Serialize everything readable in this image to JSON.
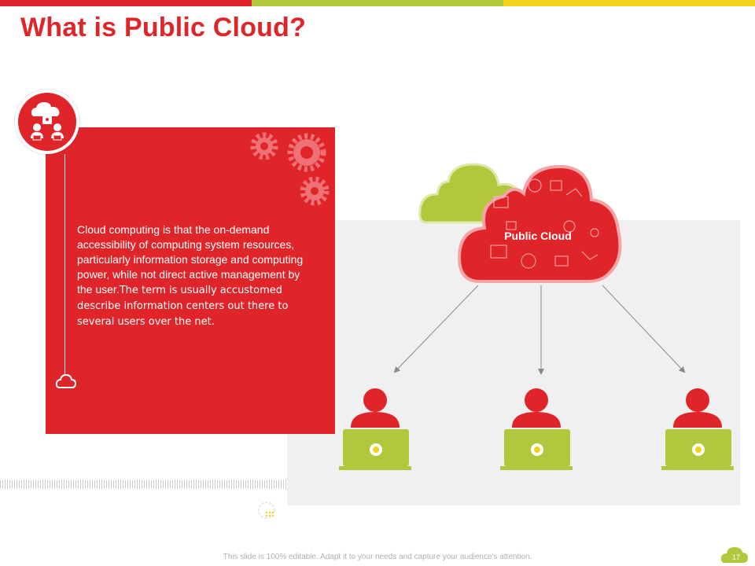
{
  "slide": {
    "title": "What is Public Cloud?",
    "description_part1": "Cloud computing is that the on-demand accessibility of computing system resources, particularly information storage and computing power, while not direct active management by the user.",
    "description_part2": "The term  is usually accustomed describe information centers out there to several users over the net.",
    "cloud_label": "Public Cloud",
    "footer_text": "This slide is 100% editable. Adapt it to your needs and capture your audience's attention.",
    "page_number": "17"
  },
  "icons": {
    "badge": "cloud-users-icon",
    "timeline_end": "cloud-outline-icon",
    "gears": "gears-icon",
    "users": "user-laptop-icon",
    "dashed_circle": "dashed-circle-icon"
  },
  "colors": {
    "accent_red": "#e0252a",
    "accent_green": "#b3c73c",
    "accent_yellow": "#f2d21c",
    "panel_grey": "#f0f0f0"
  }
}
